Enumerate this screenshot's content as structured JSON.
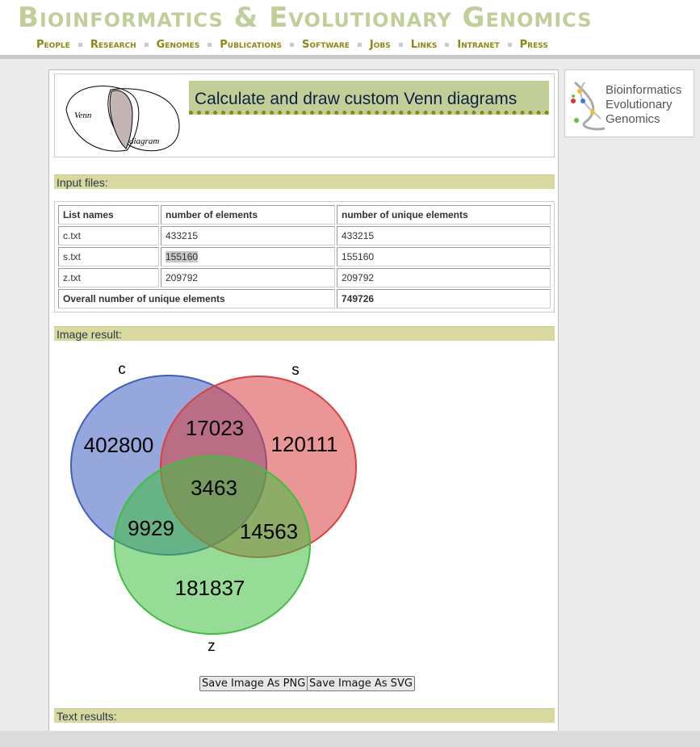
{
  "header": {
    "site_title": "Bioinformatics & Evolutionary Genomics",
    "nav": [
      "People",
      "Research",
      "Genomes",
      "Publications",
      "Software",
      "Jobs",
      "Links",
      "Intranet",
      "Press"
    ]
  },
  "logo": {
    "venn_word": "Venn",
    "diagram_word": "diagram"
  },
  "page_title": "Calculate and draw custom Venn diagrams",
  "side_logo": {
    "lines": [
      "Bioinformatics",
      "Evolutionary",
      "Genomics"
    ]
  },
  "sections": {
    "input": "Input files:",
    "image": "Image result:",
    "text": "Text results:"
  },
  "table": {
    "headers": [
      "List names",
      "number of elements",
      "number of unique elements"
    ],
    "rows": [
      [
        "c.txt",
        "433215",
        "433215"
      ],
      [
        "s.txt",
        "155160",
        "155160"
      ],
      [
        "z.txt",
        "209792",
        "209792"
      ]
    ],
    "total_label": "Overall number of unique elements",
    "total_value": "749726"
  },
  "venn": {
    "sets": [
      {
        "label": "c",
        "color": "#3f5fbf"
      },
      {
        "label": "s",
        "color": "#d93f3f"
      },
      {
        "label": "z",
        "color": "#3fbf3f"
      }
    ],
    "regions": {
      "c_only": "402800",
      "s_only": "120111",
      "z_only": "181837",
      "cs": "17023",
      "cz": "9929",
      "sz": "14563",
      "csz": "3463"
    }
  },
  "buttons": {
    "png": "Save Image As PNG",
    "svg": "Save Image As SVG"
  }
}
